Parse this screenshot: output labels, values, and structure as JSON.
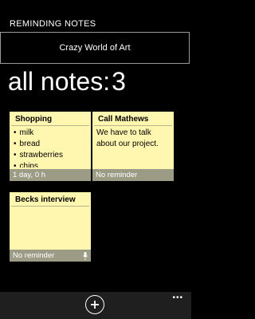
{
  "app": {
    "title": "REMINDING NOTES"
  },
  "header": {
    "text": "Crazy World of Art"
  },
  "count": {
    "label": "all notes:",
    "value": "3"
  },
  "notes": [
    {
      "title": "Shopping",
      "items": [
        "milk",
        "bread",
        "strawberries",
        "chips"
      ],
      "footer": "1 day, 0 h"
    },
    {
      "title": "Call Mathews",
      "text": "We have to talk about our project.",
      "footer": "No reminder"
    },
    {
      "title": "Becks interview",
      "text": "",
      "footer": "No reminder",
      "icon": "microphone-icon"
    }
  ],
  "appbar": {
    "add_icon": "add-circle-icon",
    "more_icon": "ellipsis-icon"
  },
  "colors": {
    "note_bg": "#fff7b0",
    "note_footer": "#9c9c86",
    "background": "#000000"
  }
}
